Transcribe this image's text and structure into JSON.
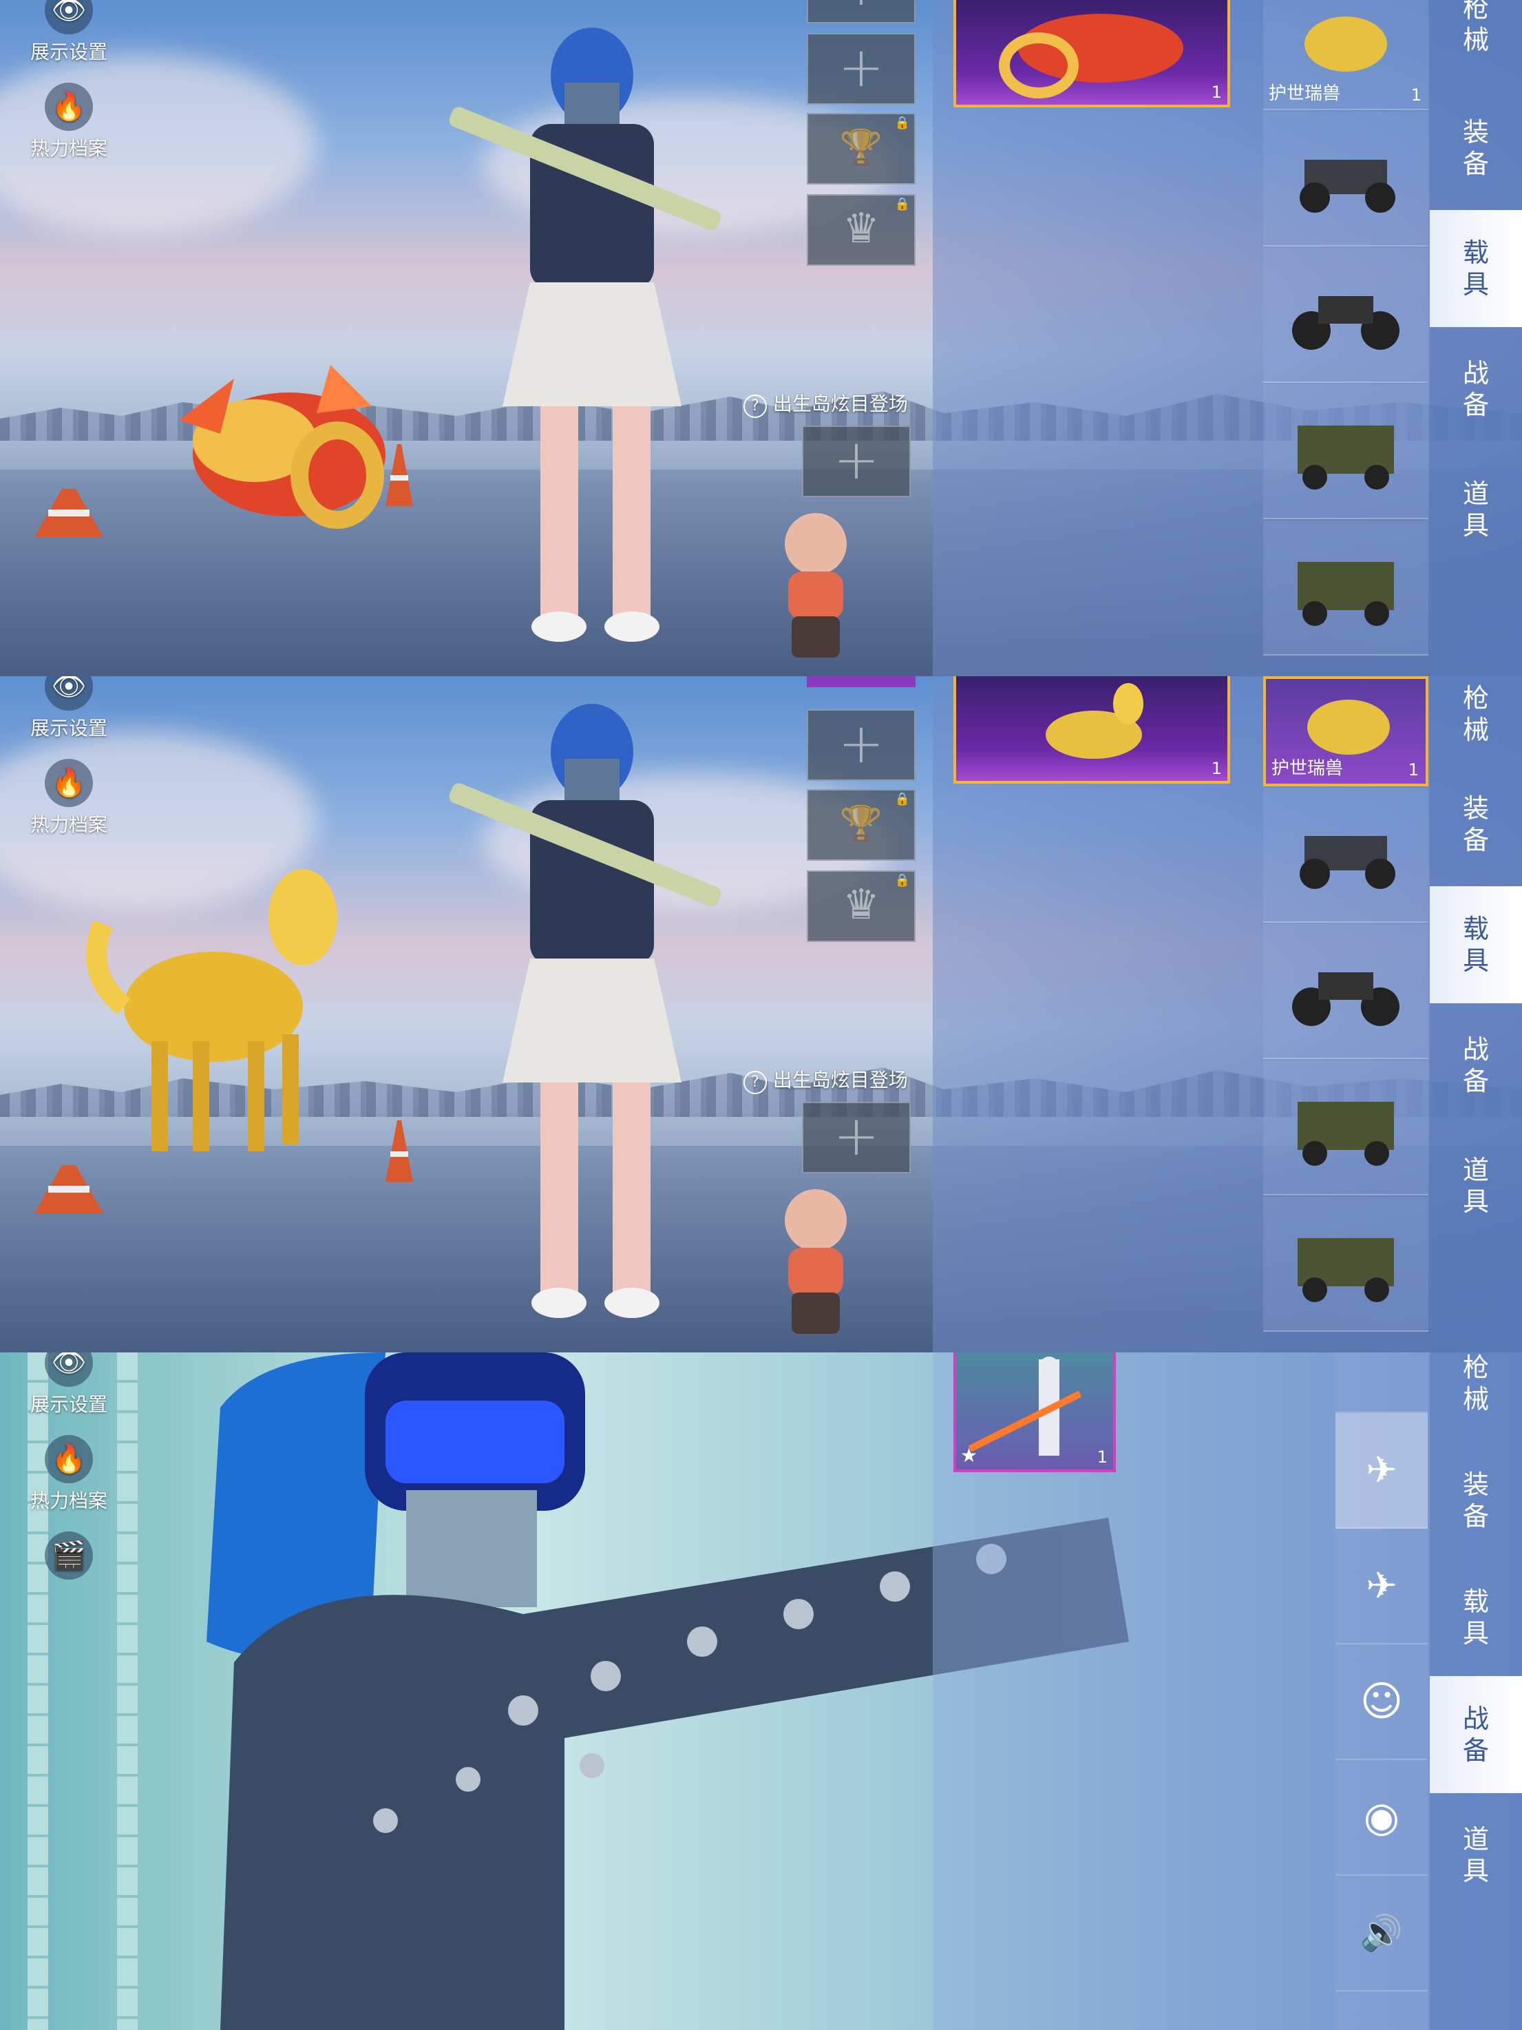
{
  "sidebar": {
    "display_settings": "展示设置",
    "heat_profile": "热力档案"
  },
  "entrance_label": "出生岛炫目登场",
  "tabs": [
    "枪械",
    "装备",
    "载具",
    "战备",
    "道具"
  ],
  "panel1": {
    "featured_count": "1",
    "items": [
      {
        "name": "护世瑞兽",
        "qty": "1"
      },
      {
        "name": "",
        "qty": ""
      },
      {
        "name": "",
        "qty": ""
      },
      {
        "name": "",
        "qty": ""
      },
      {
        "name": "",
        "qty": ""
      }
    ]
  },
  "panel2": {
    "featured_count": "1",
    "items": [
      {
        "name": "护世瑞兽",
        "qty": "1"
      },
      {
        "name": "",
        "qty": ""
      },
      {
        "name": "",
        "qty": ""
      },
      {
        "name": "",
        "qty": ""
      },
      {
        "name": "",
        "qty": ""
      }
    ]
  },
  "panel3": {
    "featured_count": "1"
  },
  "icons": {
    "eye": "👁",
    "fire": "🔥",
    "film": "🎬",
    "plus": "+",
    "lock": "🔒",
    "trophy": "🏆",
    "crown": "♛",
    "help": "?",
    "drone": "✈",
    "plane": "✈",
    "smile": "☺",
    "robot": "◉",
    "speaker": "🔊",
    "star": "★"
  },
  "colors": {
    "gold": "#f2b53a",
    "purple": "#6a2aa6",
    "tab_active": "#3a5b9a"
  }
}
